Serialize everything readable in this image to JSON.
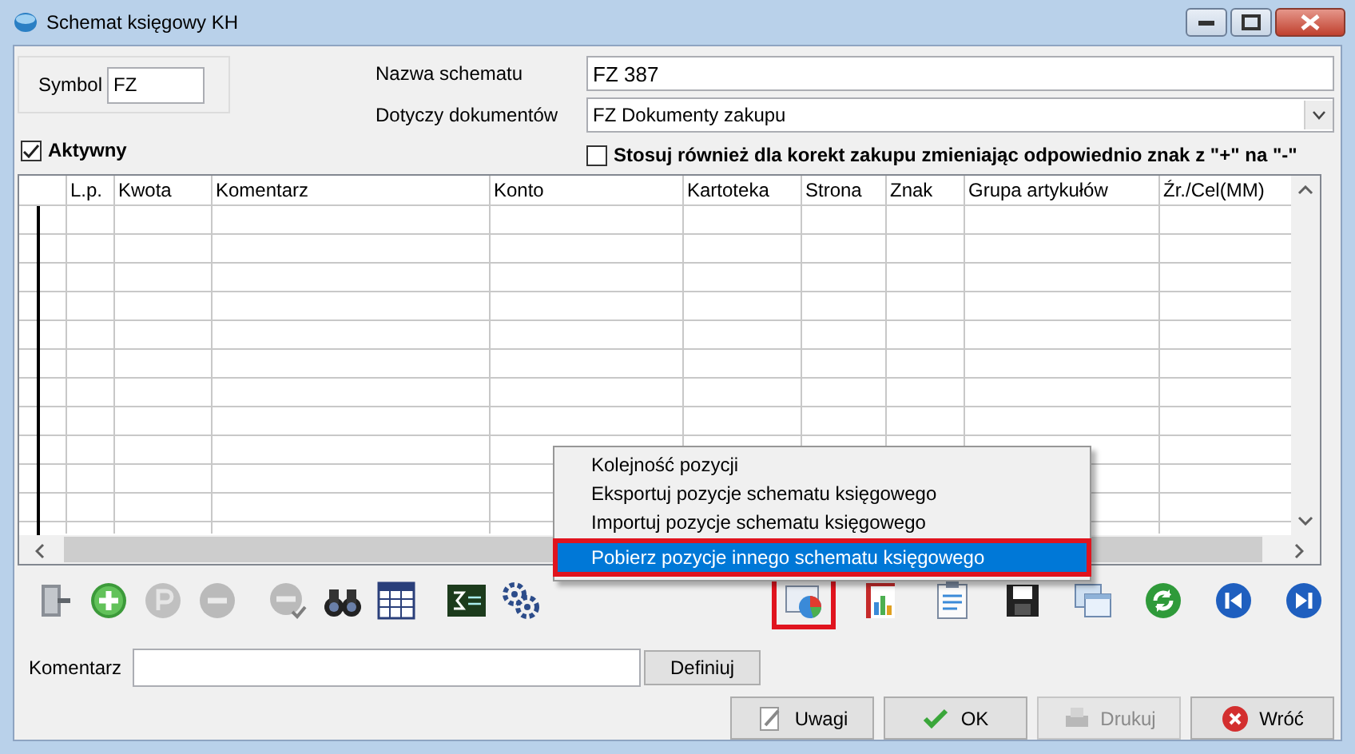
{
  "window": {
    "title": "Schemat księgowy KH"
  },
  "symbol": {
    "label": "Symbol",
    "value": "FZ"
  },
  "scheme_name": {
    "label": "Nazwa schematu",
    "value": "FZ 387"
  },
  "documents": {
    "label": "Dotyczy dokumentów",
    "value": "FZ Dokumenty zakupu"
  },
  "active": {
    "label": "Aktywny",
    "checked": true
  },
  "corrections": {
    "label": "Stosuj również dla korekt zakupu zmieniając odpowiednio znak z \"+\" na \"-\"",
    "checked": false
  },
  "table": {
    "columns": [
      "L.p.",
      "Kwota",
      "Komentarz",
      "Konto",
      "Kartoteka",
      "Strona",
      "Znak",
      "Grupa artykułów",
      "Źr./Cel(MM)"
    ]
  },
  "toolbar": [
    {
      "kind": "exit",
      "disabled": false,
      "highlighted": false
    },
    {
      "kind": "add",
      "disabled": false,
      "highlighted": false
    },
    {
      "kind": "preview",
      "disabled": true,
      "highlighted": false
    },
    {
      "kind": "remove",
      "disabled": true,
      "highlighted": false
    },
    {
      "kind": "remove-check",
      "disabled": true,
      "highlighted": false
    },
    {
      "kind": "find",
      "disabled": false,
      "highlighted": false
    },
    {
      "kind": "table",
      "disabled": false,
      "highlighted": false
    },
    {
      "kind": "formula",
      "disabled": false,
      "highlighted": false
    },
    {
      "kind": "gears",
      "disabled": false,
      "highlighted": false
    },
    {
      "kind": "import",
      "disabled": false,
      "highlighted": true
    },
    {
      "kind": "report",
      "disabled": false,
      "highlighted": false
    },
    {
      "kind": "clipboard",
      "disabled": false,
      "highlighted": false
    },
    {
      "kind": "save",
      "disabled": false,
      "highlighted": false
    },
    {
      "kind": "windows",
      "disabled": false,
      "highlighted": false
    },
    {
      "kind": "refresh",
      "disabled": false,
      "highlighted": false
    },
    {
      "kind": "prev",
      "disabled": false,
      "highlighted": false
    },
    {
      "kind": "next",
      "disabled": false,
      "highlighted": false
    }
  ],
  "context_menu": {
    "items": [
      {
        "label": "Kolejność pozycji",
        "selected": false,
        "highlighted": false
      },
      {
        "label": "Eksportuj pozycje schematu księgowego",
        "selected": false,
        "highlighted": false
      },
      {
        "label": "Importuj pozycje schematu księgowego",
        "selected": false,
        "highlighted": false
      },
      {
        "label": "Pobierz pozycje innego schematu księgowego",
        "selected": true,
        "highlighted": true
      }
    ]
  },
  "comment": {
    "label": "Komentarz",
    "button": "Definiuj"
  },
  "buttons": [
    {
      "label": "Uwagi",
      "kind": "notes",
      "disabled": false
    },
    {
      "label": "OK",
      "kind": "ok",
      "disabled": false
    },
    {
      "label": "Drukuj",
      "kind": "print",
      "disabled": true
    },
    {
      "label": "Wróć",
      "kind": "back",
      "disabled": false
    }
  ]
}
